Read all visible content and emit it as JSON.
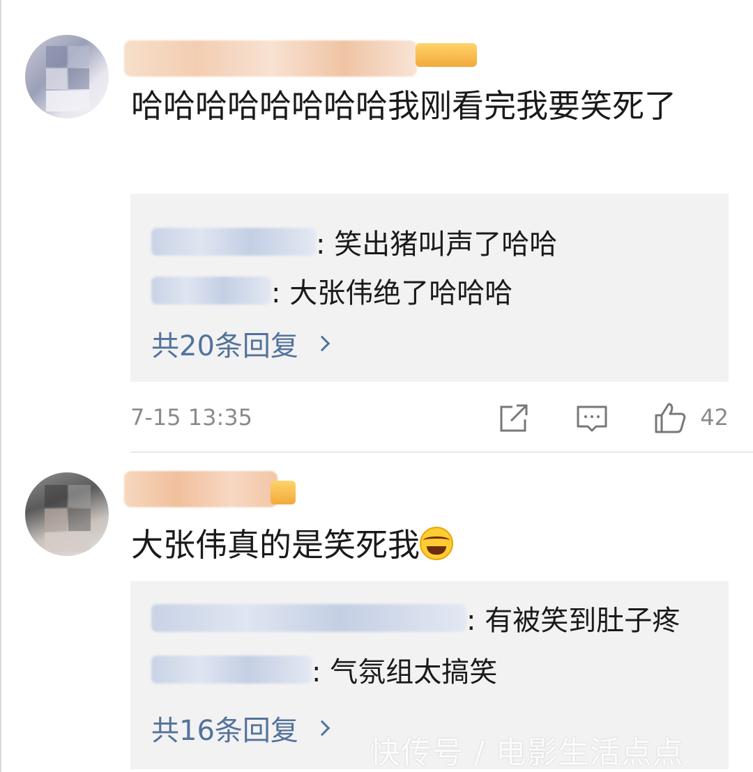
{
  "comments": [
    {
      "text": "哈哈哈哈哈哈哈哈我刚看完我要笑死了",
      "replies": [
        {
          "text": ": 笑出猪叫声了哈哈"
        },
        {
          "text": ": 大张伟绝了哈哈哈"
        }
      ],
      "more_replies": "共20条回复",
      "timestamp": "7-15 13:35",
      "like_count": "42"
    },
    {
      "text": "大张伟真的是笑死我",
      "emoji": "laughing-tears",
      "replies": [
        {
          "text": ": 有被笑到肚子疼"
        },
        {
          "text": ": 气氛组太搞笑"
        }
      ],
      "more_replies": "共16条回复"
    }
  ],
  "watermark": "快传号 / 电影生活点点",
  "colors": {
    "link": "#53729c",
    "reply_bg": "#f2f2f2",
    "meta_gray": "#8a8a8a",
    "badge": "#f2a93b"
  },
  "icons": [
    "share-icon",
    "comment-icon",
    "thumbs-up-icon",
    "chevron-right-icon"
  ]
}
